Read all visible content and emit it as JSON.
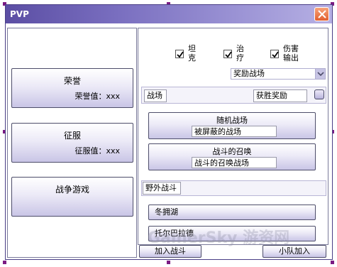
{
  "window": {
    "title": "PVP"
  },
  "left_panel": {
    "buttons": [
      {
        "label": "荣誉",
        "value": "荣誉值：xxx"
      },
      {
        "label": "征服",
        "value": "征服值：xxx"
      },
      {
        "label": "战争游戏",
        "value": ""
      }
    ]
  },
  "roles": [
    {
      "label": "坦\n克",
      "checked": true
    },
    {
      "label": "治\n疗",
      "checked": true
    },
    {
      "label": "伤害\n输出",
      "checked": true
    }
  ],
  "reward_dropdown": {
    "selected": "奖励战场"
  },
  "battlegrounds": {
    "header": "战场",
    "reward_header": "获胜奖励",
    "items": [
      {
        "title": "随机战场",
        "subtitle": "被屏蔽的战场"
      },
      {
        "title": "战斗的召唤",
        "subtitle": "战斗的召唤战场"
      }
    ]
  },
  "world_pvp": {
    "header": "野外战斗",
    "items": [
      "冬拥湖",
      "托尔巴拉德"
    ]
  },
  "footer": {
    "join_button": "加入战斗",
    "group_join_button": "小队加入"
  },
  "watermark": "GamerSky 游资网",
  "colors": {
    "titlebar": "#5b4ea4",
    "accent": "#7b1b83",
    "close": "#e25f2f"
  }
}
